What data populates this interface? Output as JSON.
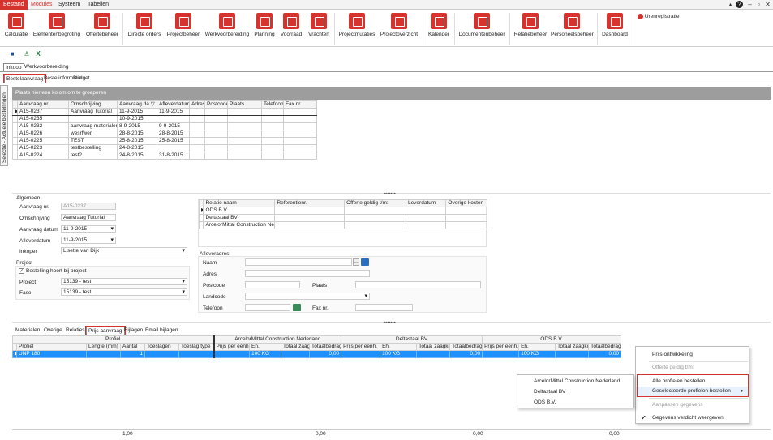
{
  "menubar": {
    "tabs": [
      "Bestand",
      "Modules",
      "Systeem",
      "Tabellen"
    ]
  },
  "ribbon": {
    "buttons": [
      "Calculatie",
      "Elementenbegroting",
      "Offertebeheer",
      "Directe orders",
      "Projectbeheer",
      "Werkvoorbereiding",
      "Planning",
      "Voorraad",
      "Vrachten",
      "Projectmutaties",
      "Projectoverzicht",
      "Kalender",
      "Documentenbeheer",
      "Relatiebeheer",
      "Personeelsbeheer",
      "Dashboard"
    ],
    "urenregistratie": "Urenregistratie"
  },
  "tabs_main": [
    "Inkoop",
    "Werkvoorbereiding"
  ],
  "tabs_sub": [
    "Bestelaanvraag",
    "Bestelinformatie",
    "Budget"
  ],
  "side_panel": "Selectie - Actuele bestellingen",
  "group_header": "Plaats hier een kolom om te groeperen",
  "top_grid": {
    "columns": [
      "Aanvraag nr.",
      "Omschrijving",
      "Aanvraag da",
      "Afleverdatum",
      "Adres",
      "Postcode",
      "Plaats",
      "Telefoon",
      "Fax nr."
    ],
    "rows": [
      [
        "A15-0237",
        "Aanvraag Tutorial",
        "11-9-2015",
        "11-9-2015",
        "",
        "",
        "",
        "",
        ""
      ],
      [
        "A15-0235",
        "",
        "10-9-2015",
        "",
        "",
        "",
        "",
        "",
        ""
      ],
      [
        "A15-0232",
        "aanvraag materialen",
        "8-9-2015",
        "9-9-2015",
        "",
        "",
        "",
        "",
        ""
      ],
      [
        "A15-0226",
        "wesrfwer",
        "28-8-2015",
        "28-8-2015",
        "",
        "",
        "",
        "",
        ""
      ],
      [
        "A15-0225",
        "TEST",
        "25-8-2015",
        "25-8-2015",
        "",
        "",
        "",
        "",
        ""
      ],
      [
        "A15-0223",
        "testbestelling",
        "24-8-2015",
        "",
        "",
        "",
        "",
        "",
        ""
      ],
      [
        "A15-0224",
        "test2",
        "24-8-2015",
        "31-8-2015",
        "",
        "",
        "",
        "",
        ""
      ]
    ]
  },
  "form": {
    "algemeen": "Algemeen",
    "aanvraag_nr_label": "Aanvraag nr.",
    "aanvraag_nr": "A15-0237",
    "omschrijving_label": "Omschrijving",
    "omschrijving": "Aanvraag Tutorial",
    "aanvraag_datum_label": "Aanvraag datum",
    "aanvraag_datum": "11-9-2015",
    "afleverdatum_label": "Afleverdatum",
    "afleverdatum": "11-9-2015",
    "inkoper_label": "Inkoper",
    "inkoper": "Lisette van Dijk",
    "project_group": "Project",
    "bestelling_project": "Bestelling hoort bij project",
    "project_label": "Project",
    "project": "15139 - test",
    "fase_label": "Fase",
    "fase": "15139 - test"
  },
  "relatie_grid": {
    "columns": [
      "Relatie naam",
      "Referentienr.",
      "Offerte geldig t/m:",
      "Leverdatum",
      "Overige kosten"
    ],
    "rows": [
      "ODS B.V.",
      "Deltastaal BV",
      "ArcelorMittal Construction Nederland"
    ]
  },
  "aflever": {
    "title": "Afleveradres",
    "naam": "Naam",
    "adres": "Adres",
    "postcode": "Postcode",
    "plaats": "Plaats",
    "landcode": "Landcode",
    "telefoon": "Telefoon",
    "fax": "Fax nr."
  },
  "tabs_bottom": [
    "Materialen",
    "Overige",
    "Relaties",
    "Prijs aanvraag",
    "Bijlagen",
    "Email bijlagen"
  ],
  "bottom_grid": {
    "profiel_header": "Profiel",
    "suppliers": [
      "ArcelorMittal Construction Nederland",
      "Deltastaal BV",
      "ODS B.V."
    ],
    "profiel_cols": [
      "Profiel",
      "Lengte (mm)",
      "Aantal",
      "Toeslagen",
      "Toeslag type"
    ],
    "supplier_cols": [
      "Prijs per eenh.",
      "Eh.",
      "Totaal zaagkos",
      "Totaalbedrag"
    ],
    "row": {
      "profiel": "UNP 180",
      "aantal": "1",
      "eh": "100 KG",
      "totaal": "0,00"
    },
    "footer_aantal": "1,00",
    "footer_totaal": "0,00"
  },
  "context_menu": {
    "items": [
      "Prijs ontwikkeling",
      "Offerte geldig t/m:",
      "Alle profielen bestellen",
      "Geselecteerde profielen bestellen",
      "Aanpassen gegevens",
      "Gegevens verdicht weergeven"
    ]
  },
  "submenu": {
    "items": [
      "ArcelorMittal Construction Nederland",
      "Deltastaal BV",
      "ODS B.V."
    ]
  },
  "colors": {
    "accent": "#d6332f",
    "selection": "#1e90ff"
  }
}
